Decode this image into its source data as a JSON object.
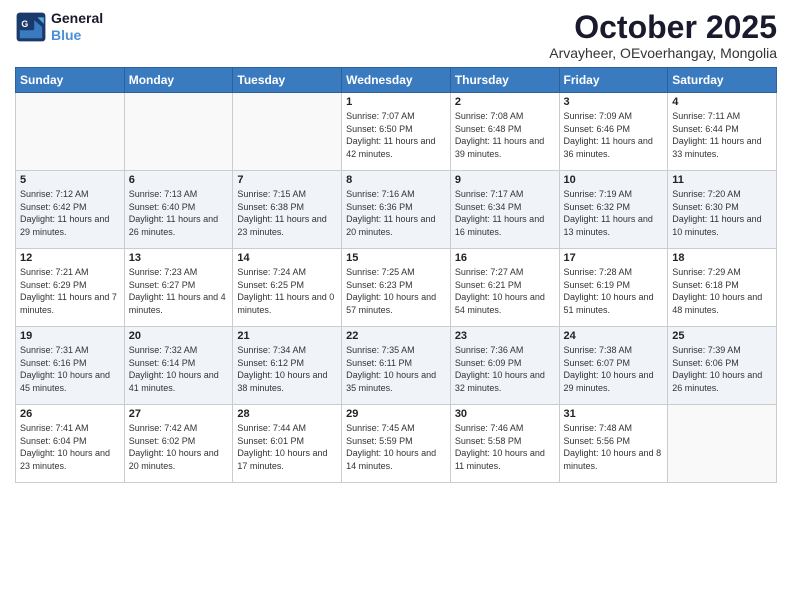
{
  "header": {
    "logo_line1": "General",
    "logo_line2": "Blue",
    "title": "October 2025",
    "subtitle": "Arvayheer, OEvoerhangay, Mongolia"
  },
  "weekdays": [
    "Sunday",
    "Monday",
    "Tuesday",
    "Wednesday",
    "Thursday",
    "Friday",
    "Saturday"
  ],
  "weeks": [
    [
      {
        "day": "",
        "sunrise": "",
        "sunset": "",
        "daylight": ""
      },
      {
        "day": "",
        "sunrise": "",
        "sunset": "",
        "daylight": ""
      },
      {
        "day": "",
        "sunrise": "",
        "sunset": "",
        "daylight": ""
      },
      {
        "day": "1",
        "sunrise": "Sunrise: 7:07 AM",
        "sunset": "Sunset: 6:50 PM",
        "daylight": "Daylight: 11 hours and 42 minutes."
      },
      {
        "day": "2",
        "sunrise": "Sunrise: 7:08 AM",
        "sunset": "Sunset: 6:48 PM",
        "daylight": "Daylight: 11 hours and 39 minutes."
      },
      {
        "day": "3",
        "sunrise": "Sunrise: 7:09 AM",
        "sunset": "Sunset: 6:46 PM",
        "daylight": "Daylight: 11 hours and 36 minutes."
      },
      {
        "day": "4",
        "sunrise": "Sunrise: 7:11 AM",
        "sunset": "Sunset: 6:44 PM",
        "daylight": "Daylight: 11 hours and 33 minutes."
      }
    ],
    [
      {
        "day": "5",
        "sunrise": "Sunrise: 7:12 AM",
        "sunset": "Sunset: 6:42 PM",
        "daylight": "Daylight: 11 hours and 29 minutes."
      },
      {
        "day": "6",
        "sunrise": "Sunrise: 7:13 AM",
        "sunset": "Sunset: 6:40 PM",
        "daylight": "Daylight: 11 hours and 26 minutes."
      },
      {
        "day": "7",
        "sunrise": "Sunrise: 7:15 AM",
        "sunset": "Sunset: 6:38 PM",
        "daylight": "Daylight: 11 hours and 23 minutes."
      },
      {
        "day": "8",
        "sunrise": "Sunrise: 7:16 AM",
        "sunset": "Sunset: 6:36 PM",
        "daylight": "Daylight: 11 hours and 20 minutes."
      },
      {
        "day": "9",
        "sunrise": "Sunrise: 7:17 AM",
        "sunset": "Sunset: 6:34 PM",
        "daylight": "Daylight: 11 hours and 16 minutes."
      },
      {
        "day": "10",
        "sunrise": "Sunrise: 7:19 AM",
        "sunset": "Sunset: 6:32 PM",
        "daylight": "Daylight: 11 hours and 13 minutes."
      },
      {
        "day": "11",
        "sunrise": "Sunrise: 7:20 AM",
        "sunset": "Sunset: 6:30 PM",
        "daylight": "Daylight: 11 hours and 10 minutes."
      }
    ],
    [
      {
        "day": "12",
        "sunrise": "Sunrise: 7:21 AM",
        "sunset": "Sunset: 6:29 PM",
        "daylight": "Daylight: 11 hours and 7 minutes."
      },
      {
        "day": "13",
        "sunrise": "Sunrise: 7:23 AM",
        "sunset": "Sunset: 6:27 PM",
        "daylight": "Daylight: 11 hours and 4 minutes."
      },
      {
        "day": "14",
        "sunrise": "Sunrise: 7:24 AM",
        "sunset": "Sunset: 6:25 PM",
        "daylight": "Daylight: 11 hours and 0 minutes."
      },
      {
        "day": "15",
        "sunrise": "Sunrise: 7:25 AM",
        "sunset": "Sunset: 6:23 PM",
        "daylight": "Daylight: 10 hours and 57 minutes."
      },
      {
        "day": "16",
        "sunrise": "Sunrise: 7:27 AM",
        "sunset": "Sunset: 6:21 PM",
        "daylight": "Daylight: 10 hours and 54 minutes."
      },
      {
        "day": "17",
        "sunrise": "Sunrise: 7:28 AM",
        "sunset": "Sunset: 6:19 PM",
        "daylight": "Daylight: 10 hours and 51 minutes."
      },
      {
        "day": "18",
        "sunrise": "Sunrise: 7:29 AM",
        "sunset": "Sunset: 6:18 PM",
        "daylight": "Daylight: 10 hours and 48 minutes."
      }
    ],
    [
      {
        "day": "19",
        "sunrise": "Sunrise: 7:31 AM",
        "sunset": "Sunset: 6:16 PM",
        "daylight": "Daylight: 10 hours and 45 minutes."
      },
      {
        "day": "20",
        "sunrise": "Sunrise: 7:32 AM",
        "sunset": "Sunset: 6:14 PM",
        "daylight": "Daylight: 10 hours and 41 minutes."
      },
      {
        "day": "21",
        "sunrise": "Sunrise: 7:34 AM",
        "sunset": "Sunset: 6:12 PM",
        "daylight": "Daylight: 10 hours and 38 minutes."
      },
      {
        "day": "22",
        "sunrise": "Sunrise: 7:35 AM",
        "sunset": "Sunset: 6:11 PM",
        "daylight": "Daylight: 10 hours and 35 minutes."
      },
      {
        "day": "23",
        "sunrise": "Sunrise: 7:36 AM",
        "sunset": "Sunset: 6:09 PM",
        "daylight": "Daylight: 10 hours and 32 minutes."
      },
      {
        "day": "24",
        "sunrise": "Sunrise: 7:38 AM",
        "sunset": "Sunset: 6:07 PM",
        "daylight": "Daylight: 10 hours and 29 minutes."
      },
      {
        "day": "25",
        "sunrise": "Sunrise: 7:39 AM",
        "sunset": "Sunset: 6:06 PM",
        "daylight": "Daylight: 10 hours and 26 minutes."
      }
    ],
    [
      {
        "day": "26",
        "sunrise": "Sunrise: 7:41 AM",
        "sunset": "Sunset: 6:04 PM",
        "daylight": "Daylight: 10 hours and 23 minutes."
      },
      {
        "day": "27",
        "sunrise": "Sunrise: 7:42 AM",
        "sunset": "Sunset: 6:02 PM",
        "daylight": "Daylight: 10 hours and 20 minutes."
      },
      {
        "day": "28",
        "sunrise": "Sunrise: 7:44 AM",
        "sunset": "Sunset: 6:01 PM",
        "daylight": "Daylight: 10 hours and 17 minutes."
      },
      {
        "day": "29",
        "sunrise": "Sunrise: 7:45 AM",
        "sunset": "Sunset: 5:59 PM",
        "daylight": "Daylight: 10 hours and 14 minutes."
      },
      {
        "day": "30",
        "sunrise": "Sunrise: 7:46 AM",
        "sunset": "Sunset: 5:58 PM",
        "daylight": "Daylight: 10 hours and 11 minutes."
      },
      {
        "day": "31",
        "sunrise": "Sunrise: 7:48 AM",
        "sunset": "Sunset: 5:56 PM",
        "daylight": "Daylight: 10 hours and 8 minutes."
      },
      {
        "day": "",
        "sunrise": "",
        "sunset": "",
        "daylight": ""
      }
    ]
  ]
}
